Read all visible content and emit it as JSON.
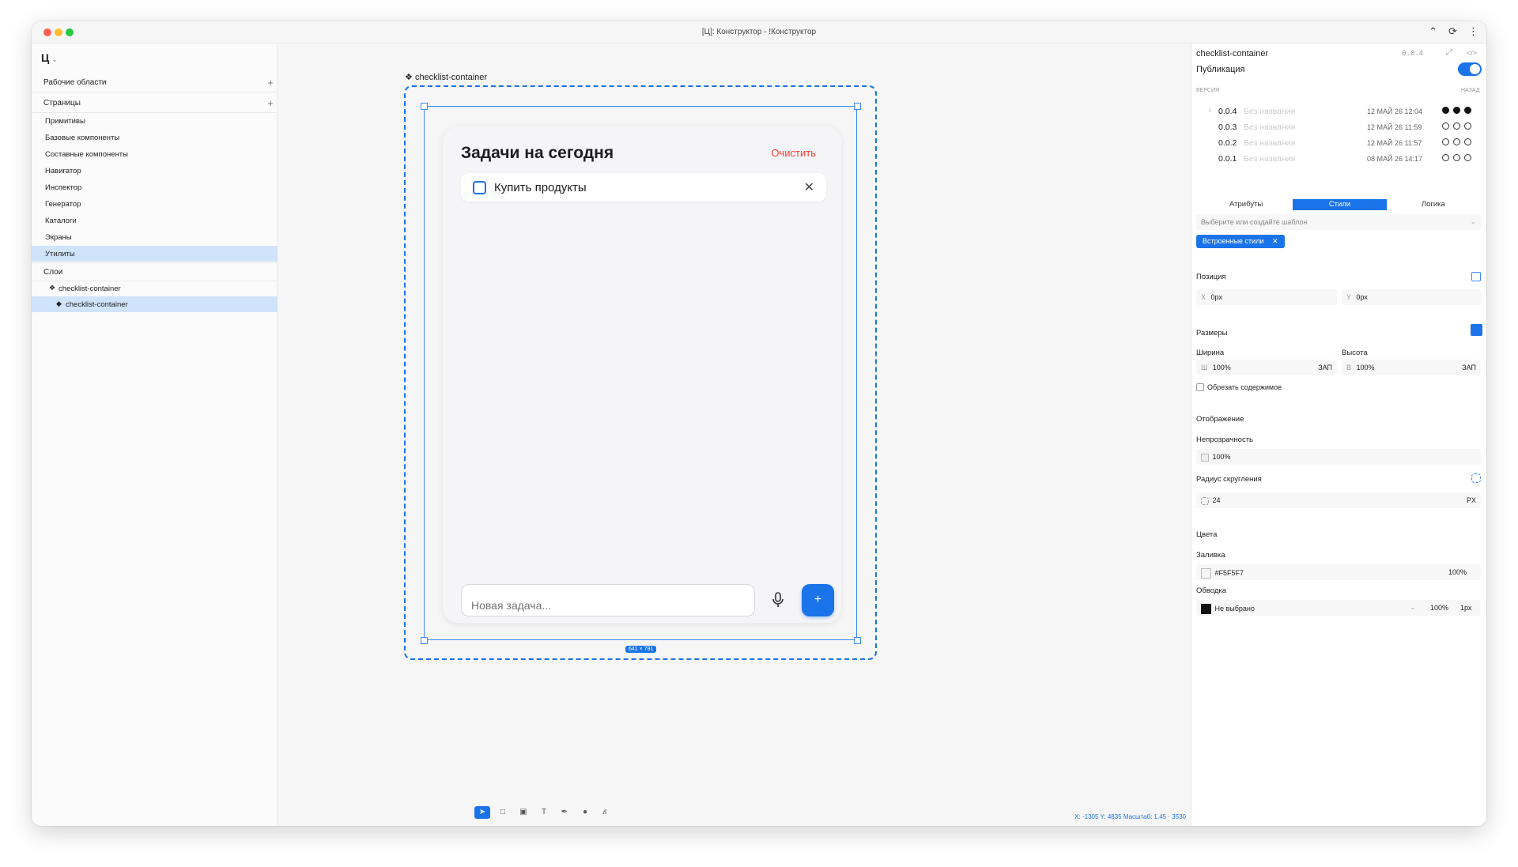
{
  "window": {
    "title": "[Ц]: Конструктор - !Конструктор"
  },
  "sidebar": {
    "logo": "Ц",
    "workspaces_label": "Рабочие области",
    "pages_label": "Страницы",
    "items": [
      {
        "label": "Примитивы"
      },
      {
        "label": "Базовые компоненты"
      },
      {
        "label": "Составные компоненты"
      },
      {
        "label": "Навигатор"
      },
      {
        "label": "Инспектор"
      },
      {
        "label": "Генератор"
      },
      {
        "label": "Каталоги"
      },
      {
        "label": "Экраны"
      },
      {
        "label": "Утилиты"
      }
    ],
    "layers_label": "Слои",
    "layers": [
      {
        "label": "checklist-container"
      },
      {
        "label": "checklist-container"
      }
    ]
  },
  "canvas": {
    "frame_label": "checklist-container",
    "size_badge": "641 × 791",
    "card": {
      "title": "Задачи на сегодня",
      "clear_label": "Очистить",
      "task_text": "Купить продукты",
      "input_placeholder": "Новая задача...",
      "add_label": "+"
    },
    "coords": "X: -1305 Y: 4835 Масштаб: 1.45 · 3530"
  },
  "inspector": {
    "component_name": "checklist-container",
    "component_version": "0.0.4",
    "publish_label": "Публикация",
    "publish_on": true,
    "version_label": "ВЕРСИЯ",
    "back_label": "НАЗАД",
    "versions": [
      {
        "num": "0.0.4",
        "name": "Без названия",
        "date": "12 МАЙ 26 12:04"
      },
      {
        "num": "0.0.3",
        "name": "Без названия",
        "date": "12 МАЙ 26 11:59"
      },
      {
        "num": "0.0.2",
        "name": "Без названия",
        "date": "12 МАЙ 26 11:57"
      },
      {
        "num": "0.0.1",
        "name": "Без названия",
        "date": "08 МАЙ 26 14:17"
      }
    ],
    "tabs": [
      {
        "label": "Атрибуты"
      },
      {
        "label": "Стили"
      },
      {
        "label": "Логика"
      }
    ],
    "template_placeholder": "Выберите или создайте шаблон",
    "chip_label": "Встроенные стили",
    "position_label": "Позиция",
    "x_prefix": "X",
    "x_value": "0px",
    "y_prefix": "Y",
    "y_value": "0px",
    "sizes_label": "Размеры",
    "width_label": "Ширина",
    "height_label": "Высота",
    "width_prefix": "Ш",
    "width_value": "100%",
    "width_unit": "ЗАП",
    "height_prefix": "В",
    "height_value": "100%",
    "height_unit": "ЗАП",
    "clip_label": "Обрезать содержимое",
    "display_label": "Отображение",
    "opacity_label": "Непрозрачность",
    "opacity_value": "100%",
    "radius_label": "Радиус скругления",
    "radius_value": "24",
    "radius_unit": "PX",
    "colors_label": "Цвета",
    "fill_label": "Заливка",
    "fill_value": "#F5F5F7",
    "fill_opacity": "100%",
    "stroke_label": "Обводка",
    "stroke_value": "Не выбрано",
    "stroke_opacity": "100%",
    "stroke_width": "1px"
  },
  "colors": {
    "accent": "#1a73e8",
    "danger": "#ff3b30",
    "fill": "#F5F5F7"
  }
}
